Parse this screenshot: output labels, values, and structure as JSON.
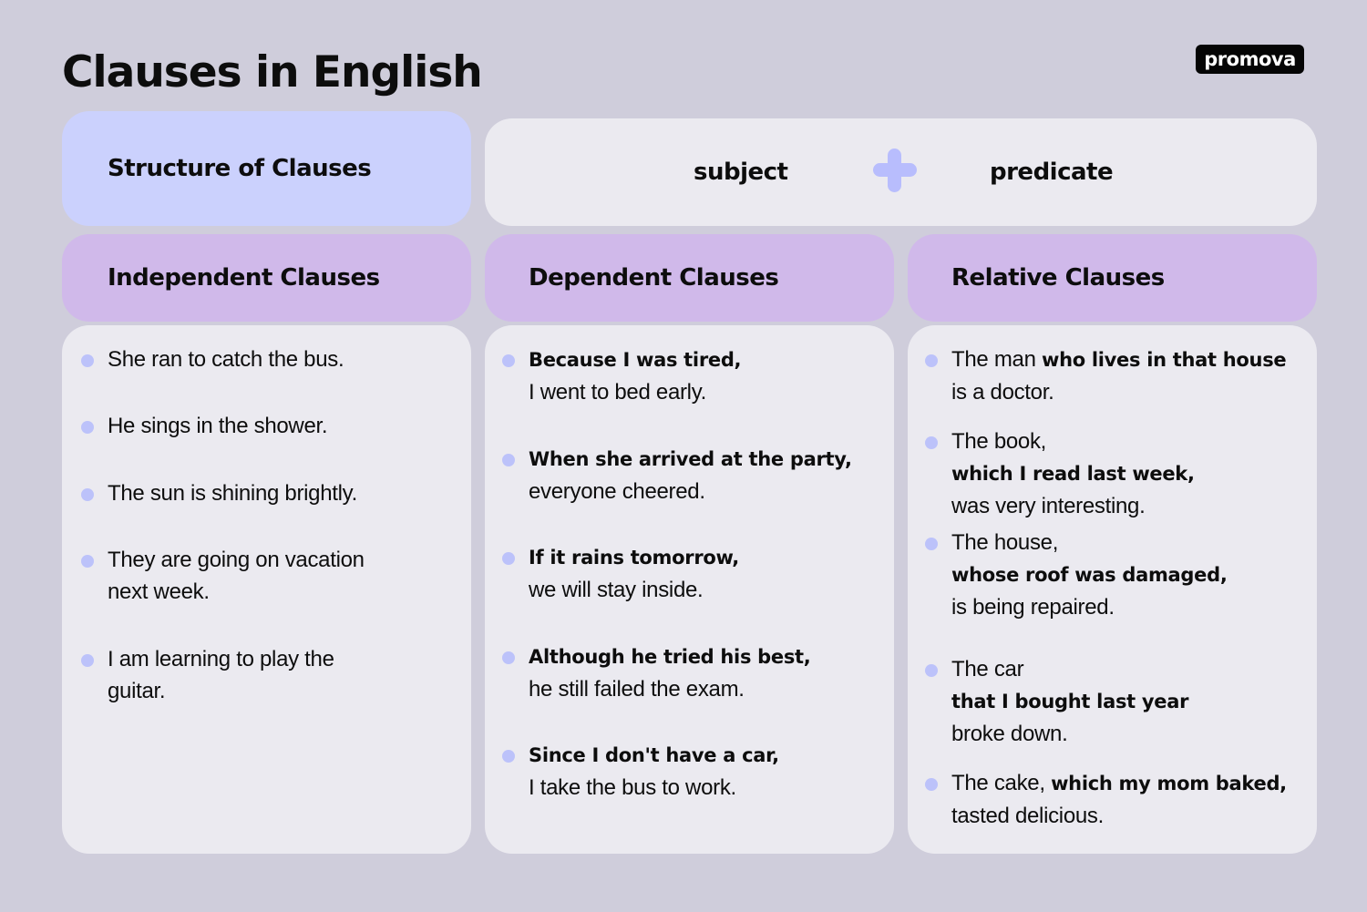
{
  "title": "Clauses in English",
  "logo": "promova",
  "structure": {
    "heading": "Structure of Clauses",
    "subject": "subject",
    "operator_icon": "plus-icon",
    "predicate": "predicate"
  },
  "colors": {
    "background": "#cfcddb",
    "structure_card": "#cbd1fd",
    "column_header": "#d0b9ea",
    "card_body": "#ebeaf0",
    "accent": "#b8bdfd"
  },
  "columns": [
    {
      "heading": "Independent Clauses",
      "items": [
        [
          {
            "t": "She ran to catch the bus."
          }
        ],
        [
          {
            "t": "He sings in the shower."
          }
        ],
        [
          {
            "t": "The sun is shining brightly."
          }
        ],
        [
          {
            "t": "They are going on vacation"
          },
          {
            "t": "next week."
          }
        ],
        [
          {
            "t": "I am learning to play the"
          },
          {
            "t": "guitar."
          }
        ]
      ]
    },
    {
      "heading": "Dependent Clauses",
      "items": [
        [
          {
            "b": "Because I was tired,"
          },
          {
            "t": "I went to bed early."
          }
        ],
        [
          {
            "b": "When she arrived at the party,"
          },
          {
            "t": "everyone cheered."
          }
        ],
        [
          {
            "b": "If it rains tomorrow,"
          },
          {
            "t": "we will stay inside."
          }
        ],
        [
          {
            "b": "Although he tried his best,"
          },
          {
            "t": "he still failed the exam."
          }
        ],
        [
          {
            "b": "Since I don't have a car,"
          },
          {
            "t": "I take the bus to work."
          }
        ]
      ]
    },
    {
      "heading": "Relative Clauses",
      "items": [
        [
          {
            "t": "The man ",
            "b": "who lives in that house"
          },
          {
            "t": "is a doctor."
          }
        ],
        [
          {
            "t": "The book,"
          },
          {
            "b": "which I read last week,"
          },
          {
            "t": "was very interesting."
          }
        ],
        [
          {
            "t": "The house,"
          },
          {
            "b": "whose roof was damaged,"
          },
          {
            "t": "is being repaired."
          }
        ],
        [
          {
            "t": "The car"
          },
          {
            "b": "that I bought last year"
          },
          {
            "t": "broke down."
          }
        ],
        [
          {
            "t": "The cake, ",
            "b": "which my mom baked,"
          },
          {
            "t": "tasted delicious."
          }
        ]
      ]
    }
  ]
}
